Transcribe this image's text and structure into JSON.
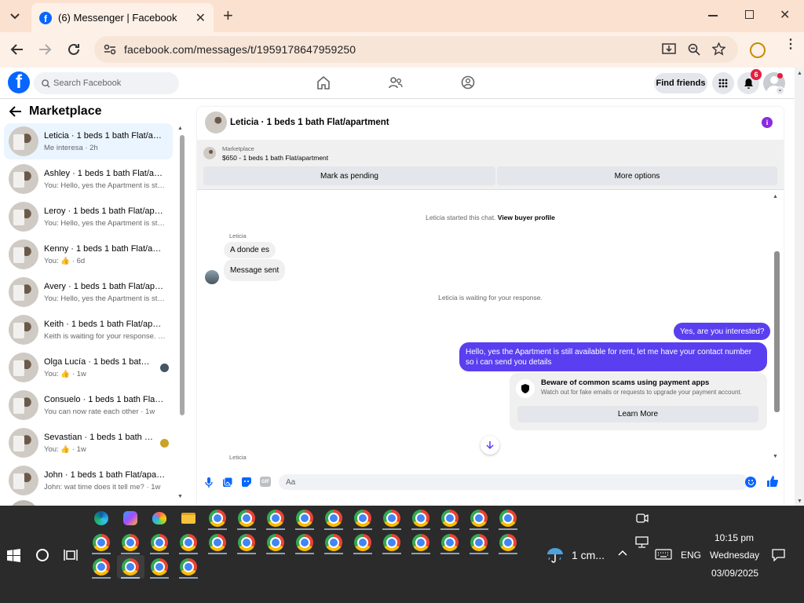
{
  "browser": {
    "tab_title": "(6) Messenger | Facebook",
    "url": "facebook.com/messages/t/1959178647959250"
  },
  "fb": {
    "search_placeholder": "Search Facebook",
    "find_friends": "Find friends",
    "notification_count": "6"
  },
  "sidebar": {
    "title": "Marketplace",
    "conversations": [
      {
        "name": "Leticia · 1 beds 1 bath Flat/apar...",
        "preview": "Me interesa · 2h"
      },
      {
        "name": "Ashley · 1 beds 1 bath Flat/apar...",
        "preview": "You: Hello, yes the Apartment is st... · 6d"
      },
      {
        "name": "Leroy · 1 beds 1 bath Flat/apart...",
        "preview": "You: Hello, yes the Apartment is st... · 6d"
      },
      {
        "name": "Kenny · 1 beds 1 bath Flat/apart...",
        "preview": "You: 👍 · 6d"
      },
      {
        "name": "Avery · 1 beds 1 bath Flat/apart...",
        "preview": "You: Hello, yes the Apartment is st... · 6d"
      },
      {
        "name": "Keith · 1 beds 1 bath Flat/apart...",
        "preview": "Keith is waiting for your response. · 6d"
      },
      {
        "name": "Olga Lucía · 1 beds 1 bath Fla...",
        "preview": "You: 👍 · 1w"
      },
      {
        "name": "Consuelo · 1 beds 1 bath Flat/a...",
        "preview": "You can now rate each other · 1w"
      },
      {
        "name": "Sevastian · 1 beds 1 bath Flat...",
        "preview": "You: 👍 · 1w"
      },
      {
        "name": "John · 1 beds 1 bath Flat/apart...",
        "preview": "John: wat time does it tell me? · 1w"
      }
    ]
  },
  "chat": {
    "header_title": "Leticia · 1 beds 1 bath Flat/apartment",
    "listing_source": "Marketplace",
    "listing_title": "$650 - 1 beds 1 bath Flat/apartment",
    "mark_pending": "Mark as pending",
    "more_options": "More options",
    "started_text": "Leticia started this chat.",
    "view_profile": "View buyer profile",
    "sender_name": "Leticia",
    "msg_in_1": "A donde es",
    "msg_in_2": "Message sent",
    "waiting_text": "Leticia is waiting for your response.",
    "msg_out_1": "Yes, are you interested?",
    "msg_out_2_line1": "Hello, yes the Apartment is still available for rent, let me have your contact number",
    "msg_out_2_line2": "so i can send you details",
    "warn_title": "Beware of common scams using payment apps",
    "warn_body": "Watch out for fake emails or requests to upgrade your payment account.",
    "learn_more": "Learn More",
    "sender_name_2": "Leticia",
    "input_placeholder": "Aa"
  },
  "taskbar": {
    "weather": "1 cm...",
    "language": "ENG",
    "time": "10:15 pm",
    "day": "Wednesday",
    "date": "03/09/2025"
  },
  "colors": {
    "tabbar": "#fbe1cf",
    "fb_blue": "#0866ff",
    "outgoing_bubble": "#5a3ff0",
    "taskbar": "#2b2b2b"
  }
}
